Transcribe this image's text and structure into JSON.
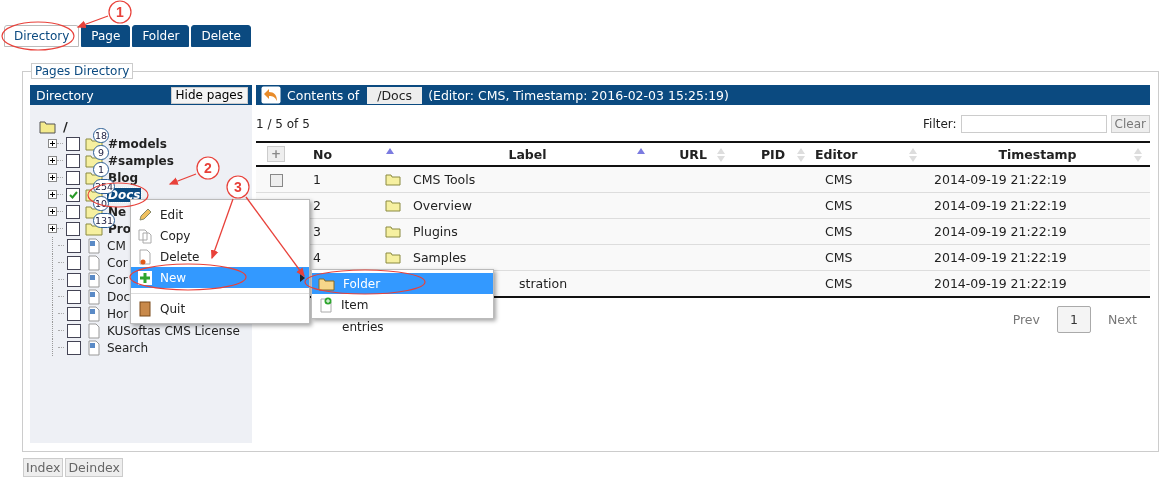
{
  "tabs": [
    {
      "label": "Directory",
      "selected": true
    },
    {
      "label": "Page",
      "selected": false
    },
    {
      "label": "Folder",
      "selected": false
    },
    {
      "label": "Delete",
      "selected": false
    }
  ],
  "panel": {
    "legend": "Pages Directory"
  },
  "directory": {
    "title": "Directory",
    "hide_button": "Hide pages",
    "tree": {
      "label": "/",
      "children": [
        {
          "label": "#models",
          "kind": "folder",
          "count": "18",
          "checked": false,
          "selected": false
        },
        {
          "label": "#samples",
          "kind": "folder",
          "count": "9",
          "checked": false,
          "selected": false
        },
        {
          "label": "Blog",
          "kind": "folder",
          "count": "1",
          "checked": false,
          "selected": false
        },
        {
          "label": "Docs",
          "kind": "folder",
          "count": "254",
          "checked": true,
          "selected": true
        },
        {
          "label": "Ne",
          "kind": "folder",
          "count": "10",
          "checked": false,
          "selected": false
        },
        {
          "label": "Pro",
          "kind": "folder",
          "count": "131",
          "checked": false,
          "selected": false
        },
        {
          "label": "CM",
          "kind": "markdown",
          "checked": false,
          "selected": false
        },
        {
          "label": "Cor",
          "kind": "page",
          "checked": false,
          "selected": false
        },
        {
          "label": "Cor",
          "kind": "markdown",
          "checked": false,
          "selected": false
        },
        {
          "label": "Doc",
          "kind": "markdown",
          "checked": false,
          "selected": false
        },
        {
          "label": "Hor",
          "kind": "markdown",
          "checked": false,
          "selected": false
        },
        {
          "label": "KUSoftas CMS License",
          "kind": "page",
          "checked": false,
          "selected": false
        },
        {
          "label": "Search",
          "kind": "markdown",
          "checked": false,
          "selected": false
        }
      ]
    }
  },
  "contents": {
    "label": "Contents of",
    "path": "/Docs",
    "info": "(Editor: CMS, Timestamp: 2016-02-03 15:25:19)",
    "range": "1 / 5 of 5",
    "filter_label": "Filter:",
    "clear_button": "Clear",
    "add_button": "+",
    "columns": [
      {
        "label": "No",
        "sorted": true
      },
      {
        "label": "Label",
        "sorted": true
      },
      {
        "label": "URL",
        "sorted": false
      },
      {
        "label": "PID",
        "sorted": false
      },
      {
        "label": "Editor",
        "sorted": false
      },
      {
        "label": "Timestamp",
        "sorted": false
      }
    ],
    "rows": [
      {
        "checked": false,
        "no": "1",
        "label": "CMS Tools",
        "editor": "CMS",
        "timestamp": "2014-09-19 21:22:19"
      },
      {
        "no": "2",
        "label": "Overview",
        "editor": "CMS",
        "timestamp": "2014-09-19 21:22:19"
      },
      {
        "no": "3",
        "label": "Plugins",
        "editor": "CMS",
        "timestamp": "2014-09-19 21:22:19"
      },
      {
        "no": "4",
        "label": "Samples",
        "editor": "CMS",
        "timestamp": "2014-09-19 21:22:19"
      },
      {
        "label": "stration",
        "editor": "CMS",
        "timestamp": "2014-09-19 21:22:19"
      }
    ],
    "entries": "entries",
    "pagination": {
      "prev": "Prev",
      "prev_disabled": true,
      "pages": [
        {
          "label": "1",
          "selected": true
        }
      ],
      "next": "Next",
      "next_disabled": true
    }
  },
  "context_menu": {
    "items": [
      {
        "label": "Edit",
        "selected": false
      },
      {
        "label": "Copy",
        "selected": false
      },
      {
        "label": "Delete",
        "selected": false
      },
      {
        "label": "New",
        "selected": true,
        "submenu": true
      },
      {
        "label": "Quit",
        "selected": false,
        "separator_before": true
      }
    ],
    "submenu": [
      {
        "label": "Folder",
        "selected": true
      },
      {
        "label": "Item",
        "selected": false
      }
    ]
  },
  "footer_buttons": [
    "Index",
    "Deindex"
  ],
  "annotations": [
    {
      "label": "1"
    },
    {
      "label": "2"
    },
    {
      "label": "3"
    }
  ]
}
